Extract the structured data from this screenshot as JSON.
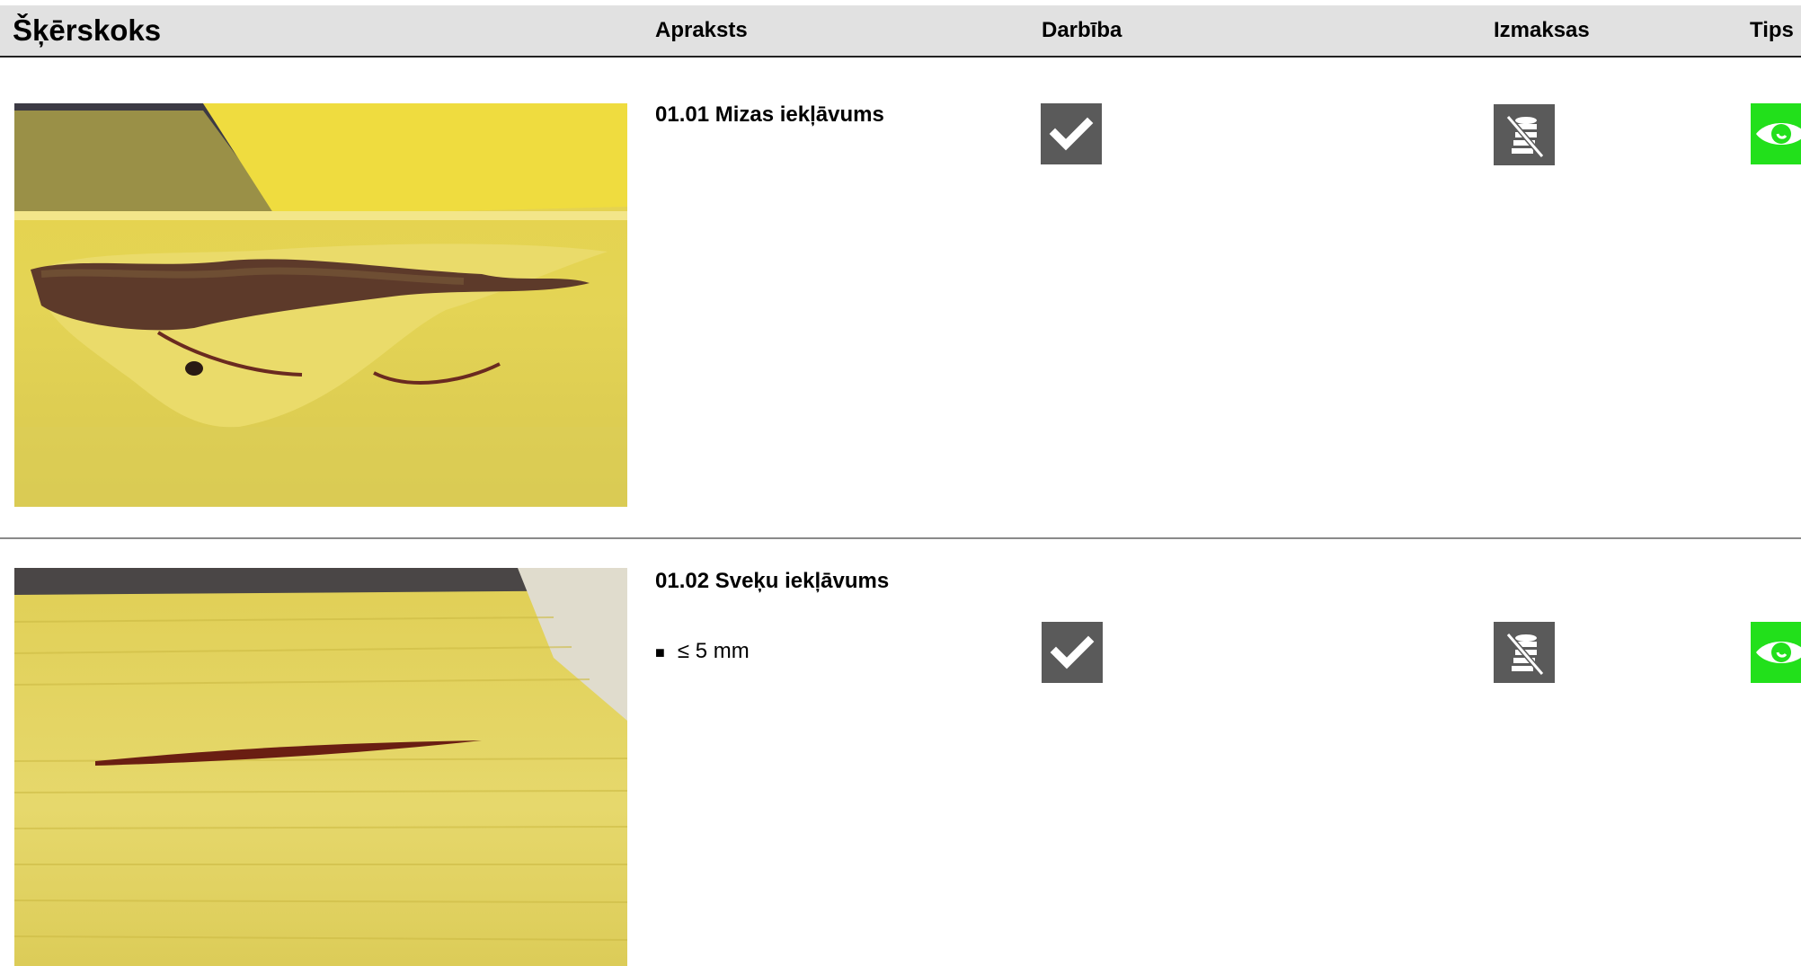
{
  "header": {
    "title": "Šķērskoks",
    "col_description": "Apraksts",
    "col_action": "Darbība",
    "col_costs": "Izmaksas",
    "col_tips": "Tips"
  },
  "items": [
    {
      "title": "01.01 Mizas iekļāvums",
      "bullets": [],
      "action_icon": "checkmark-icon",
      "cost_icon": "no-cost-coins-icon",
      "tips_icon": "eye-icon"
    },
    {
      "title": "01.02 Sveķu iekļāvums",
      "bullets": [
        "≤ 5 mm"
      ],
      "bullet_marker": "■",
      "action_icon": "checkmark-icon",
      "cost_icon": "no-cost-coins-icon",
      "tips_icon": "eye-icon"
    }
  ],
  "colors": {
    "header_bg": "#e1e1e1",
    "icon_gray": "#5a5a5a",
    "tips_green": "#22e01b",
    "wood_yellow": "#e8d64a"
  }
}
